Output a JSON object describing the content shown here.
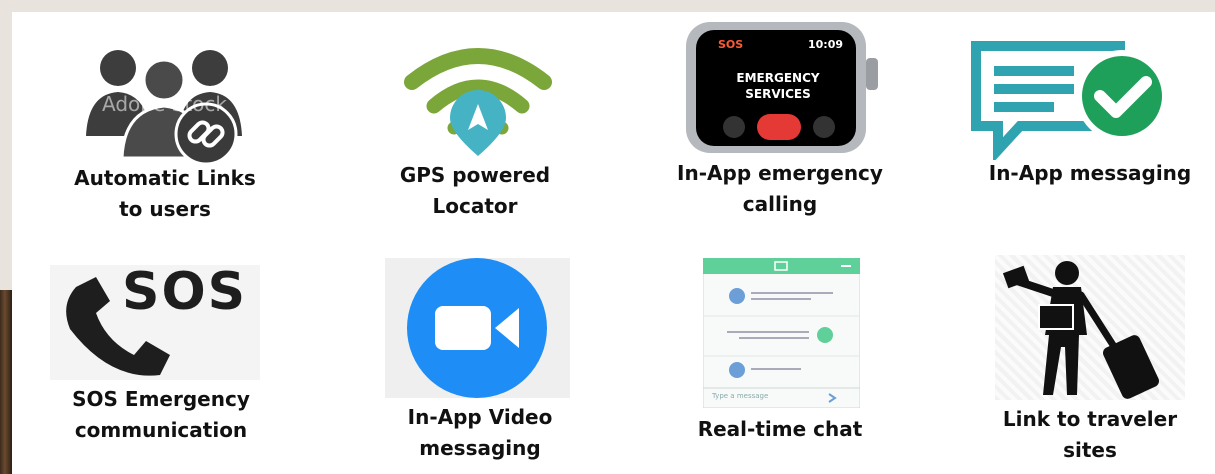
{
  "features": [
    {
      "label": "Automatic Links\nto users",
      "icon": "linked-users-icon"
    },
    {
      "label": "GPS powered\nLocator",
      "icon": "gps-locator-icon"
    },
    {
      "label": "In-App emergency\ncalling",
      "icon": "smartwatch-emergency-icon"
    },
    {
      "label": "In-App messaging",
      "icon": "message-check-icon"
    },
    {
      "label": "SOS Emergency\ncommunication",
      "icon": "sos-phone-icon"
    },
    {
      "label": "In-App Video\nmessaging",
      "icon": "video-camera-icon"
    },
    {
      "label": "Real-time chat",
      "icon": "chat-window-icon"
    },
    {
      "label": "Link to traveler\nsites",
      "icon": "traveler-icon"
    }
  ],
  "watch": {
    "sos": "SOS",
    "time": "10:09",
    "title": "EMERGENCY\nSERVICES"
  },
  "sos_text": "SOS",
  "watermark": "Adobe Stock",
  "chat_placeholder": "Type a message",
  "colors": {
    "green": "#7ba63a",
    "teal": "#46b3c4",
    "msg_teal": "#2fa3b0",
    "check_green": "#1fa05a",
    "video_blue": "#1e8df5",
    "chat_green": "#5fd09a",
    "red": "#e53935"
  }
}
